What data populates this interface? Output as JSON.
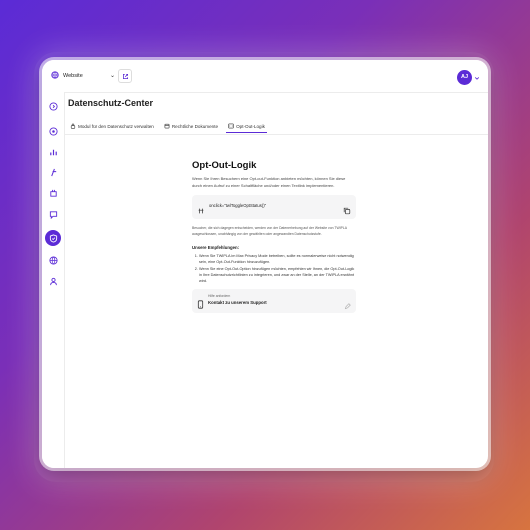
{
  "topbar": {
    "site_label": "Website",
    "avatar_initials": "AJ"
  },
  "page": {
    "title": "Datenschutz-Center"
  },
  "tabs": [
    {
      "label": "Modul für den Datenschutz verwalten"
    },
    {
      "label": "Rechtliche Dokumente"
    },
    {
      "label": "Opt-Out-Logik"
    }
  ],
  "content": {
    "heading": "Opt-Out-Logik",
    "intro": "Wenn Sie Ihren Besuchern eine Opt-out-Funktion anbieten möchten, können Sie diese durch einen Aufruf zu einer Schaltfläche und/oder einen Textlink implementieren.",
    "code": "onclick=\"twlToggleOptStatus()\"",
    "note": "Besucher, die sich dagegen entscheiden, werden von der Datenerhebung auf der Website von TWIPLA ausgeschlossen, unabhängig von der gewählten oder angewandten Datenschutzstufe.",
    "recommendations_title": "Unsere Empfehlungen:",
    "recommendations": [
      "Wenn Sie TWIPLA im Max Privacy Mode betreiben, sollte es normalerweise nicht notwendig sein, eine Opt-Out-Funktion hinzuzufügen.",
      "Wenn Sie eine Opt-Out-Option hinzufügen möchten, empfehlen wir Ihnen, die Opt-Out-Logik in Ihre Datenschutzrichtlinien zu integrieren, und zwar an der Stelle, an der TWIPLA erwähnt wird."
    ],
    "support_small": "Hilfe anfordern",
    "support_label": "Kontakt zu unserem Support"
  },
  "colors": {
    "accent": "#5b2bd6"
  }
}
